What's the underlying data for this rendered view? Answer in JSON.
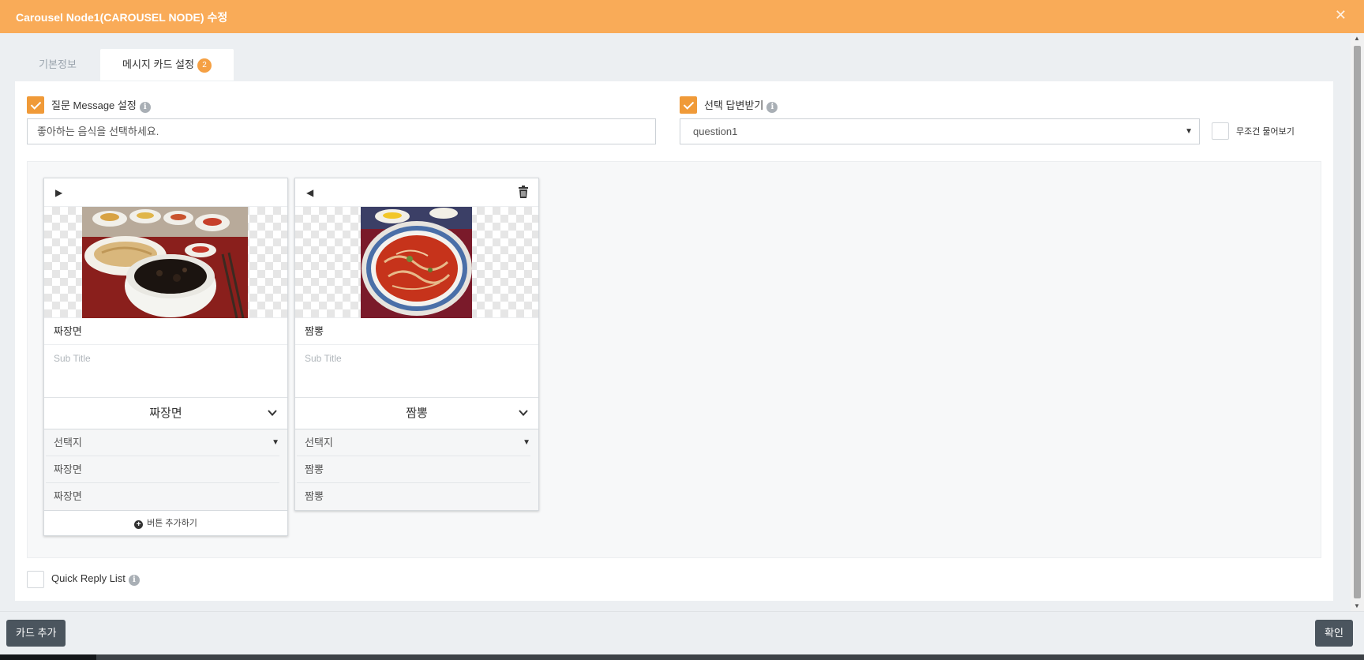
{
  "modal": {
    "title": "Carousel Node1(CAROUSEL NODE) 수정",
    "close_glyph": "✕"
  },
  "tabs": [
    {
      "label": "기본정보"
    },
    {
      "label": "메시지 카드 설정",
      "badge": "2"
    }
  ],
  "question_message": {
    "label": "질문 Message 설정",
    "checked": true,
    "value": "좋아하는 음식을 선택하세요."
  },
  "choice_answer": {
    "label": "선택 답변받기",
    "checked": true,
    "selected": "question1"
  },
  "always_ask": {
    "label": "무조건 물어보기",
    "checked": false
  },
  "cards": [
    {
      "nav_glyph": "▶",
      "title": "짜장면",
      "subtitle_placeholder": "Sub Title",
      "button_header": "짜장면",
      "rows": [
        "선택지",
        "짜장면",
        "짜장면"
      ],
      "add_button_label": "버튼 추가하기",
      "has_delete": false,
      "has_add": true
    },
    {
      "nav_glyph": "◀",
      "title": "짬뽕",
      "subtitle_placeholder": "Sub Title",
      "button_header": "짬뽕",
      "rows": [
        "선택지",
        "짬뽕",
        "짬뽕"
      ],
      "has_delete": true,
      "has_add": false
    }
  ],
  "quick_reply": {
    "label": "Quick Reply List",
    "checked": false
  },
  "footer": {
    "add_card_label": "카드 추가",
    "confirm_label": "확인"
  },
  "colors": {
    "titlebar": "#f9ab58",
    "accent": "#f09a38",
    "footer_button": "#4b555e"
  },
  "icons": {
    "info": "info-icon",
    "trash": "trash-icon",
    "chevron": "chevron-down-icon",
    "dropdown": "dropdown-arrow-icon",
    "plus": "plus-circle-icon"
  }
}
